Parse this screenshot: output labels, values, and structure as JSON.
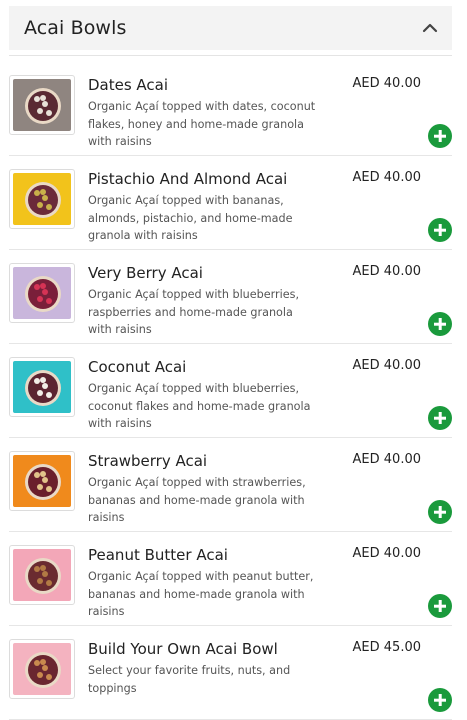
{
  "section": {
    "title": "Acai Bowls"
  },
  "currency_color": "#1a9a3c",
  "items": [
    {
      "name": "Dates Acai",
      "description": "Organic Açaí topped with dates, coconut flakes, honey and home-made granola with raisins",
      "price": "AED 40.00",
      "thumb_bg": "#8f8580",
      "bowl": "#5a2a33",
      "topping": "#e8e2d8"
    },
    {
      "name": "Pistachio And Almond Acai",
      "description": "Organic Açaí topped with bananas, almonds, pistachio, and home-made granola with raisins",
      "price": "AED 40.00",
      "thumb_bg": "#f2c31b",
      "bowl": "#6b2a3a",
      "topping": "#c9b04a"
    },
    {
      "name": "Very Berry Acai",
      "description": "Organic Açaí topped with blueberries, raspberries and home-made granola with raisins",
      "price": "AED 40.00",
      "thumb_bg": "#c9b6dc",
      "bowl": "#7a1f3a",
      "topping": "#d63355"
    },
    {
      "name": "Coconut Acai",
      "description": "Organic Açaí topped with blueberries, coconut flakes and home-made granola with raisins",
      "price": "AED 40.00",
      "thumb_bg": "#2fc0c8",
      "bowl": "#5b2430",
      "topping": "#f1ede6"
    },
    {
      "name": "Strawberry Acai",
      "description": "Organic Açaí topped with strawberries, bananas and home-made granola with raisins",
      "price": "AED 40.00",
      "thumb_bg": "#f08a1c",
      "bowl": "#6a1f2c",
      "topping": "#e2c28a"
    },
    {
      "name": "Peanut Butter Acai",
      "description": "Organic Açaí topped with peanut butter, bananas and home-made granola with raisins",
      "price": "AED 40.00",
      "thumb_bg": "#f3a7b8",
      "bowl": "#6a2b30",
      "topping": "#b27a44"
    },
    {
      "name": "Build Your Own Acai Bowl",
      "description": "Select your favorite fruits, nuts, and toppings",
      "price": "AED 45.00",
      "thumb_bg": "#f4b3c0",
      "bowl": "#6a2630",
      "topping": "#c98a4e"
    }
  ]
}
